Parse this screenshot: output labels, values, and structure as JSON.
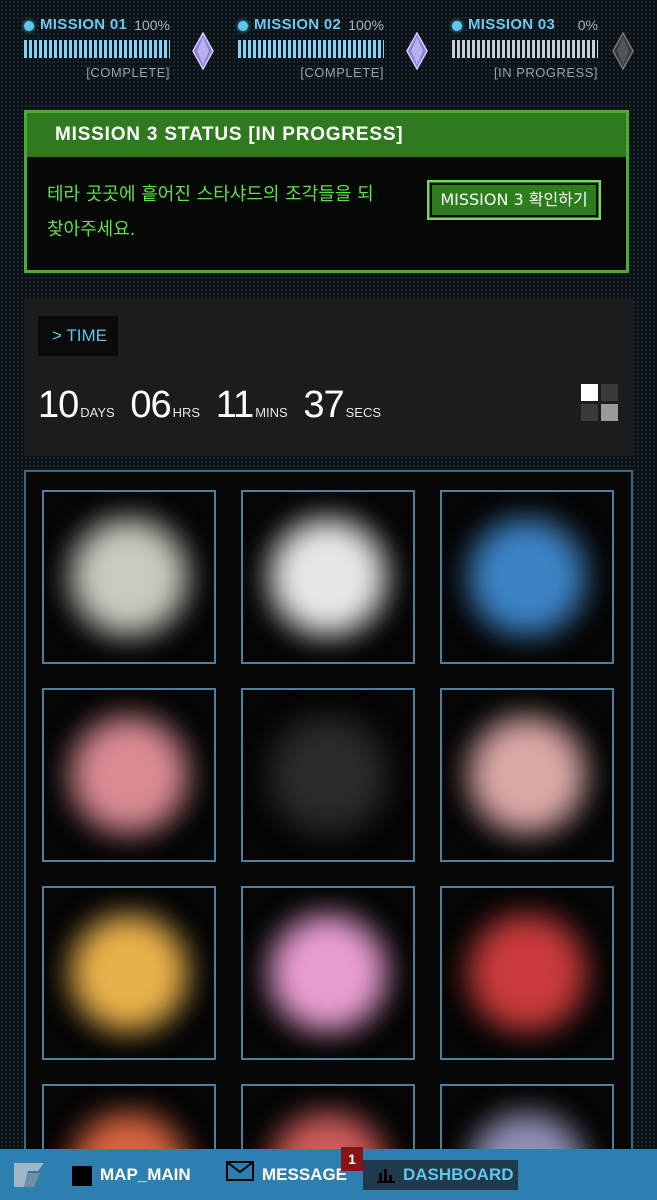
{
  "missions": [
    {
      "name": "MISSION 01",
      "percent": "100%",
      "progress": 1.0,
      "state": "[COMPLETE]"
    },
    {
      "name": "MISSION 02",
      "percent": "100%",
      "progress": 1.0,
      "state": "[COMPLETE]"
    },
    {
      "name": "MISSION 03",
      "percent": "0%",
      "progress": 0.0,
      "state": "[IN PROGRESS]"
    }
  ],
  "status": {
    "title": "MISSION 3 STATUS  [IN PROGRESS]",
    "body": "테라 곳곳에 흩어진 스타샤드의 조각들을 되찾아주세요.",
    "button": "MISSION 3 확인하기"
  },
  "time": {
    "label": "> TIME",
    "days": "10",
    "days_unit": "DAYS",
    "hrs": "06",
    "hrs_unit": "HRS",
    "mins": "11",
    "mins_unit": "MINS",
    "secs": "37",
    "secs_unit": "SECS"
  },
  "shards": {
    "tiles": [
      {
        "color": "#c9c9c0",
        "name": "shard-white"
      },
      {
        "color": "#e4e7e6",
        "name": "shard-pearl"
      },
      {
        "color": "#3c83c4",
        "name": "shard-blue"
      },
      {
        "color": "#d98a92",
        "name": "shard-pink-red"
      },
      {
        "color": "#2a2a2e",
        "name": "shard-dark"
      },
      {
        "color": "#d9a7a5",
        "name": "shard-ring"
      },
      {
        "color": "#e8b04a",
        "name": "shard-rainbow"
      },
      {
        "color": "#e79ccf",
        "name": "shard-pink"
      },
      {
        "color": "#c93a3a",
        "name": "shard-red-star"
      },
      {
        "color": "#d8643f",
        "name": "shard-orange"
      },
      {
        "color": "#cf5b5b",
        "name": "shard-red"
      },
      {
        "color": "#8f8fb4",
        "name": "shard-violet"
      }
    ]
  },
  "nav": {
    "map": "MAP_MAIN",
    "message": "MESSAGE",
    "message_badge": "1",
    "dashboard": "DASHBOARD"
  },
  "colors": {
    "accent_blue": "#5fc6ee",
    "status_green": "#4caa37",
    "nav_blue": "#2c7fae"
  }
}
